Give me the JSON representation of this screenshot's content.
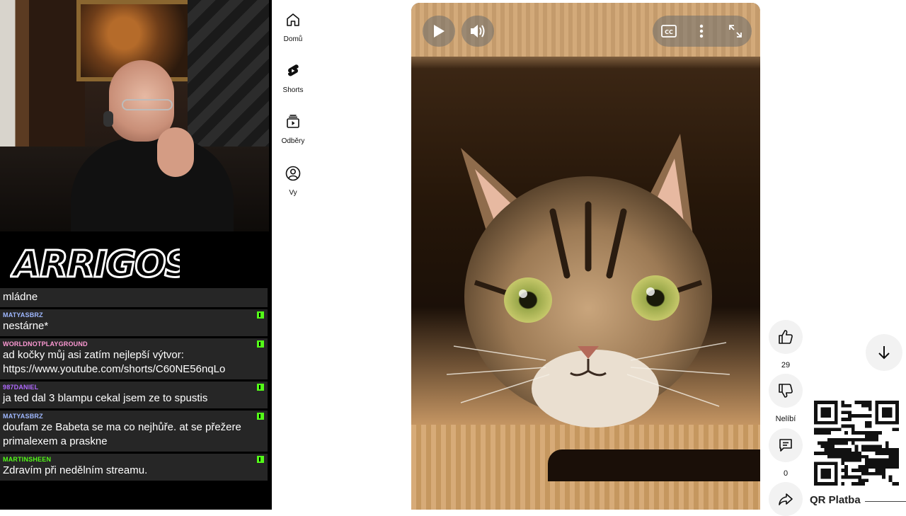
{
  "stream": {
    "logo_text": "ARRIGOS",
    "chat": [
      {
        "user": "",
        "user_color": "#ffffff",
        "text": "mládne"
      },
      {
        "user": "MATYASBRZ",
        "user_color": "#9fb8ff",
        "text": "nestárne*"
      },
      {
        "user": "WORLDNOTPLAYGROUND",
        "user_color": "#ff9ad5",
        "text": "ad kočky můj asi zatím nejlepší výtvor: https://www.youtube.com/shorts/C60NE56nqLo"
      },
      {
        "user": "987DANIEL",
        "user_color": "#b069ff",
        "text": "ja ted dal 3 blampu cekal jsem ze to spustis"
      },
      {
        "user": "MATYASBRZ",
        "user_color": "#9fb8ff",
        "text": "doufam ze Babeta se ma co nejhůře. at se přežere primalexem a praskne"
      },
      {
        "user": "MARTINSHEEN",
        "user_color": "#53fc18",
        "text": "Zdravím při nedělním streamu."
      }
    ]
  },
  "nav": {
    "items": [
      {
        "label": "Domů",
        "icon": "home-icon"
      },
      {
        "label": "Shorts",
        "icon": "shorts-icon"
      },
      {
        "label": "Odběry",
        "icon": "subscriptions-icon"
      },
      {
        "label": "Vy",
        "icon": "you-icon"
      }
    ]
  },
  "player": {
    "controls": [
      "play-icon",
      "volume-icon",
      "captions-icon",
      "more-vert-icon",
      "fullscreen-icon"
    ],
    "captions_label": "CC"
  },
  "actions": {
    "like_count": "29",
    "dislike_label": "Nelíbí",
    "comment_count": "0"
  },
  "qr": {
    "label": "QR Platba"
  },
  "colors": {
    "kick_green": "#53fc18",
    "chat_bg": "#262626",
    "action_bg": "#f2f2f2"
  }
}
